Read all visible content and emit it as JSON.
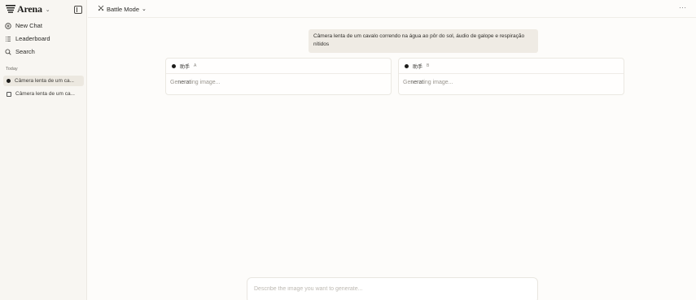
{
  "brand": {
    "name": "Arena"
  },
  "sidebar": {
    "nav": [
      {
        "label": "New Chat",
        "icon": "new-chat-icon"
      },
      {
        "label": "Leaderboard",
        "icon": "leaderboard-icon"
      },
      {
        "label": "Search",
        "icon": "search-icon"
      }
    ],
    "section_label": "Today",
    "history": [
      {
        "label": "Câmera lenta de um ca...",
        "icon": "dot-icon",
        "active": true
      },
      {
        "label": "Câmera lenta de um ca...",
        "icon": "image-icon",
        "active": false
      }
    ]
  },
  "header": {
    "mode_label": "Battle Mode",
    "more_label": "···"
  },
  "prompt": {
    "text": "Câmera lenta de um cavalo correndo na água ao pôr do sol, áudio de galope e respiração nítidos"
  },
  "cards": [
    {
      "model": "助手",
      "slot": "A",
      "status_pre": "Ge",
      "status_mid": "nerat",
      "status_post": "ing image..."
    },
    {
      "model": "助手",
      "slot": "B",
      "status_pre": "Ge",
      "status_mid": "nerat",
      "status_post": "ing image..."
    }
  ],
  "composer": {
    "placeholder": "Describe the image you want to generate..."
  }
}
